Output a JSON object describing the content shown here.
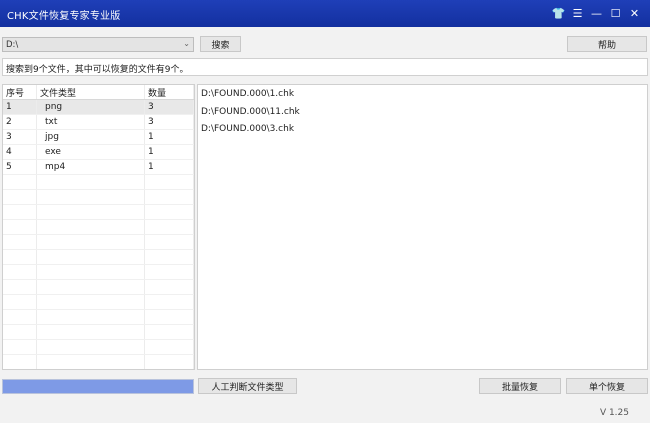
{
  "window": {
    "title": "CHK文件恢复专家专业版"
  },
  "window_controls": [
    {
      "name": "shirt-icon",
      "glyph": "👕"
    },
    {
      "name": "menu-icon",
      "glyph": "☰"
    },
    {
      "name": "minimize-icon",
      "glyph": "—"
    },
    {
      "name": "maximize-icon",
      "glyph": "☐"
    },
    {
      "name": "close-icon",
      "glyph": "✕"
    }
  ],
  "toolbar": {
    "path_value": "D:\\",
    "search_label": "搜索",
    "help_label": "帮助"
  },
  "status": {
    "text": "搜索到9个文件，其中可以恢复的文件有9个。"
  },
  "type_table": {
    "headers": [
      "序号",
      "文件类型",
      "数量"
    ],
    "rows": [
      [
        "1",
        "png",
        "3"
      ],
      [
        "2",
        "txt",
        "3"
      ],
      [
        "3",
        "jpg",
        "1"
      ],
      [
        "4",
        "exe",
        "1"
      ],
      [
        "5",
        "mp4",
        "1"
      ]
    ],
    "selected_row": 0,
    "empty_rows": 13
  },
  "files": [
    "D:\\FOUND.000\\1.chk",
    "D:\\FOUND.000\\11.chk",
    "D:\\FOUND.000\\3.chk"
  ],
  "progress": {
    "fraction": 1.0
  },
  "bottom": {
    "manual_label": "人工判断文件类型",
    "batch_label": "批量恢复",
    "single_label": "单个恢复",
    "version": "V 1.25"
  }
}
